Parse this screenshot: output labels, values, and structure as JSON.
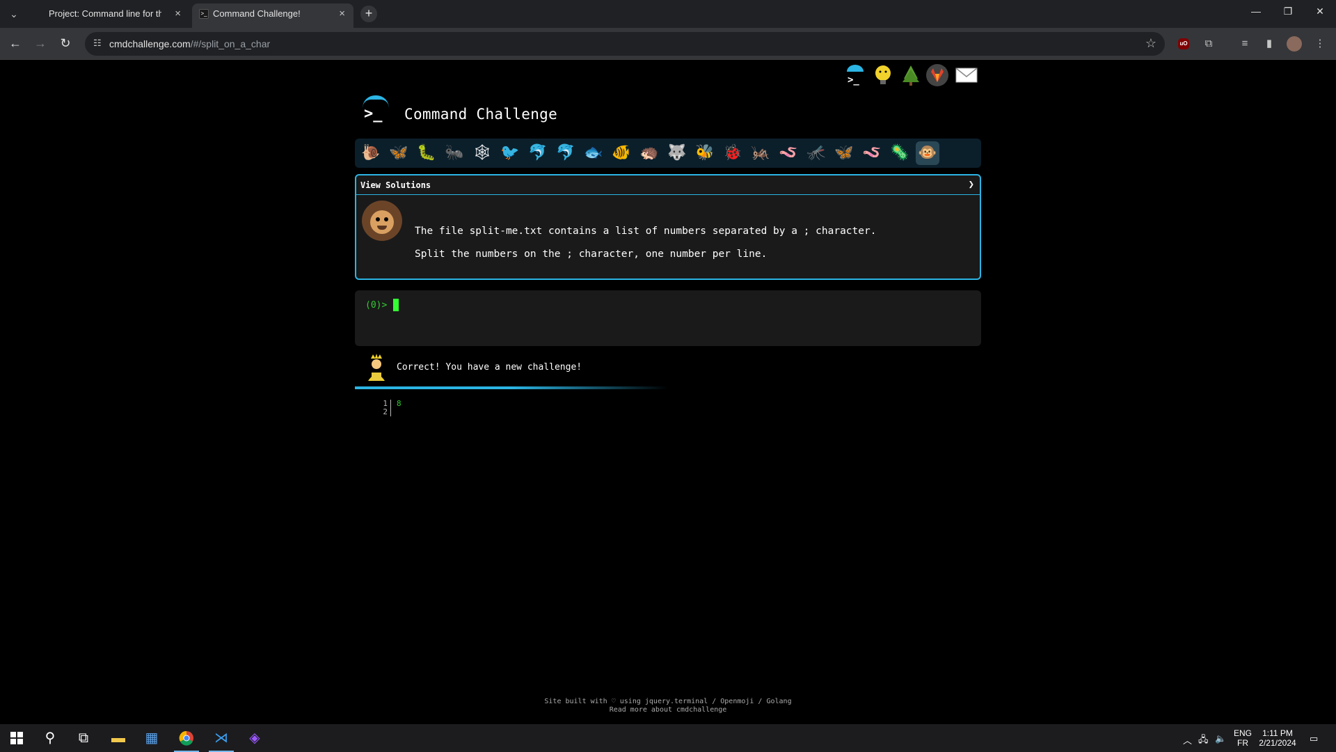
{
  "browser": {
    "tabs": [
      {
        "title": "Project: Command line for the v",
        "active": false
      },
      {
        "title": "Command Challenge!",
        "active": true
      }
    ],
    "new_tab": "+",
    "tab_close": "×",
    "url_host": "cmdchallenge.com",
    "url_path": "/#/split_on_a_char"
  },
  "site": {
    "title": "Command Challenge",
    "logo_prompt": ">_",
    "top_icons": [
      "terminal-umbrella-icon",
      "lightbulb-face-icon",
      "tree-icon",
      "gitlab-icon",
      "envelope-icon"
    ],
    "challenge_icons": [
      "🐌",
      "🦋",
      "🐛",
      "🐜",
      "🕸",
      "🐦",
      "🐬",
      "🐬",
      "🐟",
      "🐠",
      "🦔",
      "🐺",
      "🐝",
      "🐞",
      "🦗",
      "🪱",
      "🦟",
      "🦋",
      "🪱",
      "🦠",
      "🐵"
    ],
    "view_solutions_label": "View Solutions",
    "challenge_lines": [
      "The file split-me.txt contains a list of numbers separated by a ; character.",
      "Split the numbers on the ; character, one number per line."
    ],
    "prompt": "(0)>",
    "result_message": "Correct! You have a new challenge!",
    "output_line_numbers": [
      "1",
      "2"
    ],
    "output_lines": [
      "8"
    ],
    "footer_line1": "Site built with ♡ using jquery.terminal / Openmoji / Golang",
    "footer_line2": "Read more about cmdchallenge"
  },
  "progress": {
    "fraction": 0.5
  },
  "taskbar": {
    "lang_top": "ENG",
    "lang_bottom": "FR",
    "time": "1:11 PM",
    "date": "2/21/2024"
  },
  "colors": {
    "accent": "#2bb5e4",
    "terminal_green": "#33cc33",
    "panel": "#1a1a1a"
  }
}
